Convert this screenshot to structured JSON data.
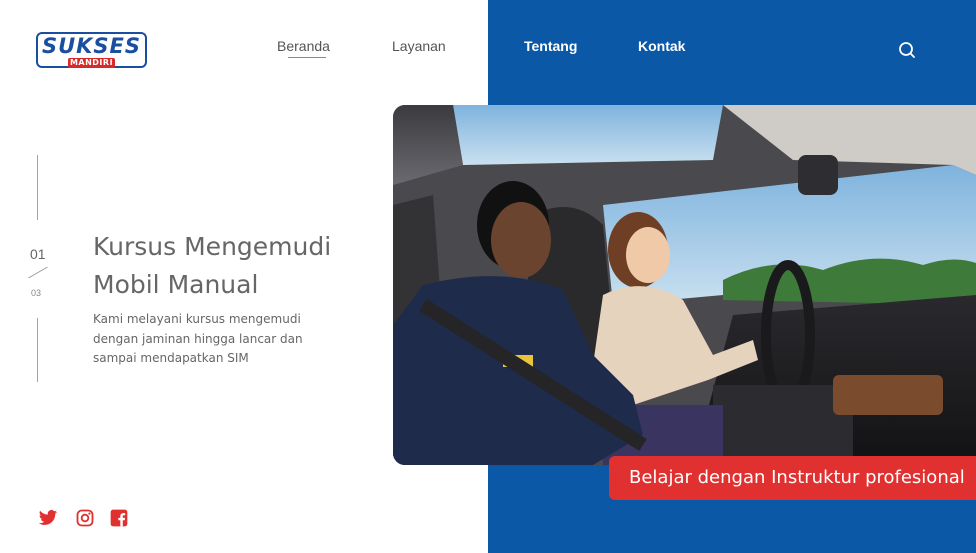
{
  "brand": {
    "logo_main": "SUKSES",
    "logo_sub": "MANDIRI"
  },
  "nav": {
    "items": [
      {
        "label": "Beranda",
        "active": true
      },
      {
        "label": "Layanan",
        "active": false
      },
      {
        "label": "Tentang",
        "active": false
      },
      {
        "label": "Kontak",
        "active": false
      }
    ],
    "search_icon": "search-icon"
  },
  "slider": {
    "current": "01",
    "total": "03"
  },
  "hero": {
    "title_line1": "Kursus Mengemudi",
    "title_line2": "Mobil Manual",
    "description": "Kami melayani kursus mengemudi dengan jaminan hingga lancar dan sampai mendapatkan SIM"
  },
  "image": {
    "subject": "instructor-and-student-driving-car"
  },
  "banner": {
    "text": "Belajar dengan Instruktur profesional"
  },
  "social": [
    {
      "icon": "twitter-icon"
    },
    {
      "icon": "instagram-icon"
    },
    {
      "icon": "facebook-icon"
    }
  ],
  "colors": {
    "primary_blue": "#0b58a6",
    "accent_red": "#e0302f",
    "logo_blue": "#1a4fa0",
    "text_gray": "#666666"
  }
}
